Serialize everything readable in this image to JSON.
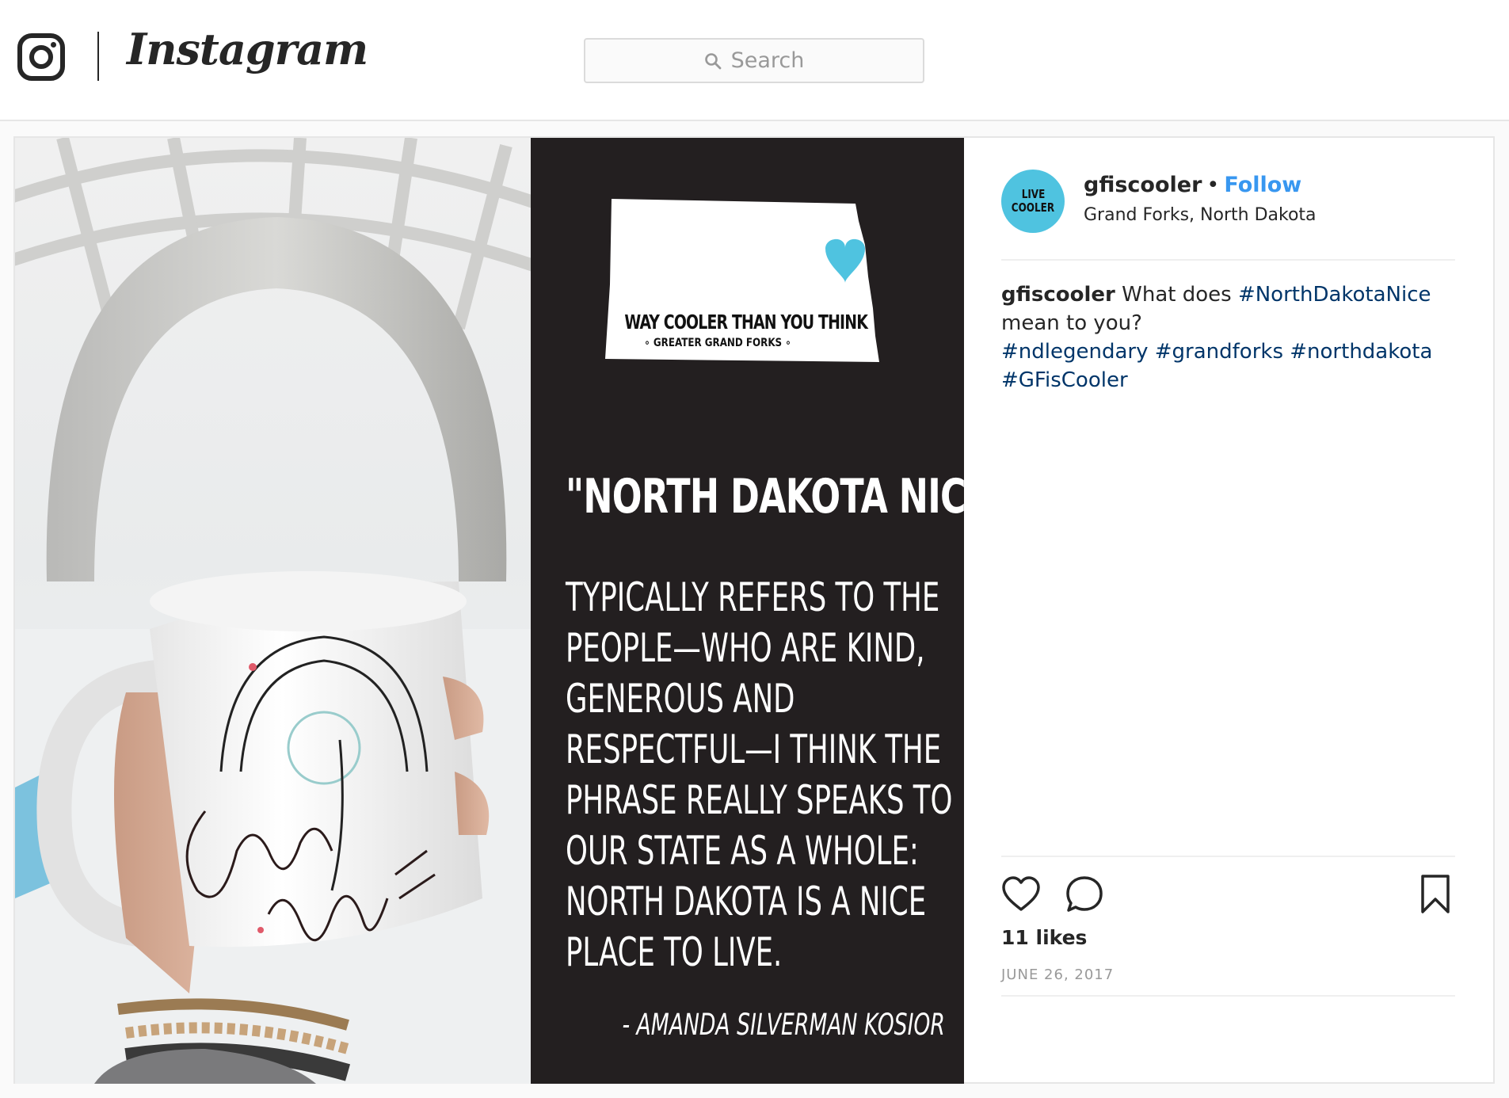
{
  "header": {
    "logo_icon": "instagram-camera-icon",
    "wordmark": "Instagram",
    "search": {
      "placeholder": "Search",
      "icon": "search-icon"
    }
  },
  "post": {
    "image": {
      "graphic": {
        "state_tagline": "WAY COOLER THAN YOU THINK",
        "state_subtag": "∘ GREATER GRAND FORKS ∘",
        "heart_color": "#4fc3e0",
        "title": "\"NORTH DAKOTA NICE\"",
        "body_lines": [
          "Typically refers to the",
          "people—who are kind,",
          "generous and",
          "respectful—I think the",
          "phrase really speaks to",
          "our state as a whole:",
          "North Dakota is a nice",
          "place to live."
        ],
        "credit": "- AMANDA SILVERMAN KOSIOR"
      }
    },
    "owner": {
      "avatar_text_line1": "LIVE",
      "avatar_text_line2": "COOLER",
      "avatar_color": "#4fc3e0",
      "username": "gfiscooler",
      "separator": "•",
      "follow_label": "Follow",
      "location": "Grand Forks, North Dakota"
    },
    "caption": {
      "username": "gfiscooler",
      "text_before": " What does ",
      "tag1": "#NorthDakotaNice",
      "text_after": " mean to you?",
      "tag2": "#ndlegendary",
      "tag3": "#grandforks",
      "tag4": "#northdakota",
      "tag5": "#GFisCooler"
    },
    "actions": {
      "like_icon": "heart-icon",
      "comment_icon": "comment-icon",
      "save_icon": "bookmark-icon"
    },
    "likes": "11 likes",
    "date": "JUNE 26, 2017"
  }
}
